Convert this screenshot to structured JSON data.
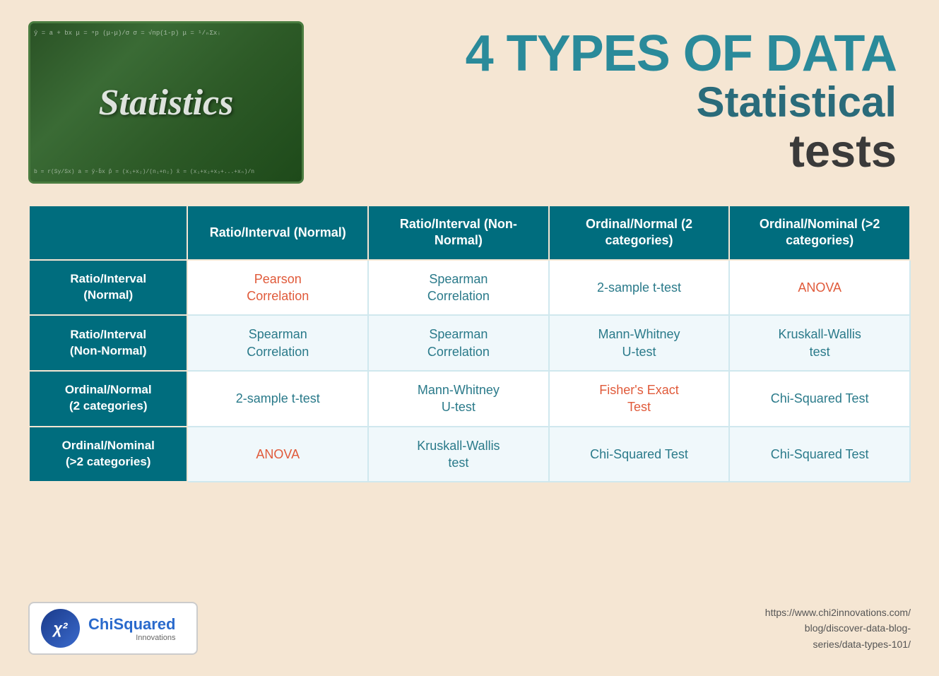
{
  "page": {
    "background": "#f5e6d3"
  },
  "header": {
    "title_main": "4 TYPES OF DATA",
    "title_sub1": "Statistical",
    "title_sub2": "tests"
  },
  "chalkboard": {
    "formulas_top": "ŷ = a + bx  μ = ⁿp   (μ-μ)/σ  σ = √np(1-p)  μ = ¹/ₙΣxᵢ",
    "label": "Statistics",
    "formulas_bottom": "b = r(Sy/Sx)  a = ȳ-b̄x   p̂ = (x₁+x₂)/(n₁+n₂)  x̄ = (x₁+x₂+x₃+...+xₙ)/n"
  },
  "table": {
    "headers": [
      "",
      "Ratio/Interval\n(Normal)",
      "Ratio/Interval\n(Non-Normal)",
      "Ordinal/Normal\n(2 categories)",
      "Ordinal/Nominal\n(>2 categories)"
    ],
    "rows": [
      {
        "row_header": "Ratio/Interval\n(Normal)",
        "cells": [
          "Pearson\nCorrelation",
          "Spearman\nCorrelation",
          "2-sample t-test",
          "ANOVA"
        ],
        "cell_classes": [
          "salmon",
          "teal",
          "teal",
          "salmon"
        ]
      },
      {
        "row_header": "Ratio/Interval\n(Non-Normal)",
        "cells": [
          "Spearman\nCorrelation",
          "Spearman\nCorrelation",
          "Mann-Whitney\nU-test",
          "Kruskall-Wallis\ntest"
        ],
        "cell_classes": [
          "teal",
          "teal",
          "teal",
          "teal"
        ]
      },
      {
        "row_header": "Ordinal/Normal\n(2 categories)",
        "cells": [
          "2-sample t-test",
          "Mann-Whitney\nU-test",
          "Fisher's Exact\nTest",
          "Chi-Squared Test"
        ],
        "cell_classes": [
          "teal",
          "teal",
          "salmon",
          "teal"
        ]
      },
      {
        "row_header": "Ordinal/Nominal\n(>2 categories)",
        "cells": [
          "ANOVA",
          "Kruskall-Wallis\ntest",
          "Chi-Squared Test",
          "Chi-Squared Test"
        ],
        "cell_classes": [
          "salmon",
          "teal",
          "teal",
          "teal"
        ]
      }
    ]
  },
  "footer": {
    "logo_symbol": "χ²",
    "logo_name_chi": "Chi",
    "logo_name_squared": "Squared",
    "logo_sub": "Innovations",
    "url_line1": "https://www.chi2innovations.com/",
    "url_line2": "blog/discover-data-blog-",
    "url_line3": "series/data-types-101/"
  }
}
